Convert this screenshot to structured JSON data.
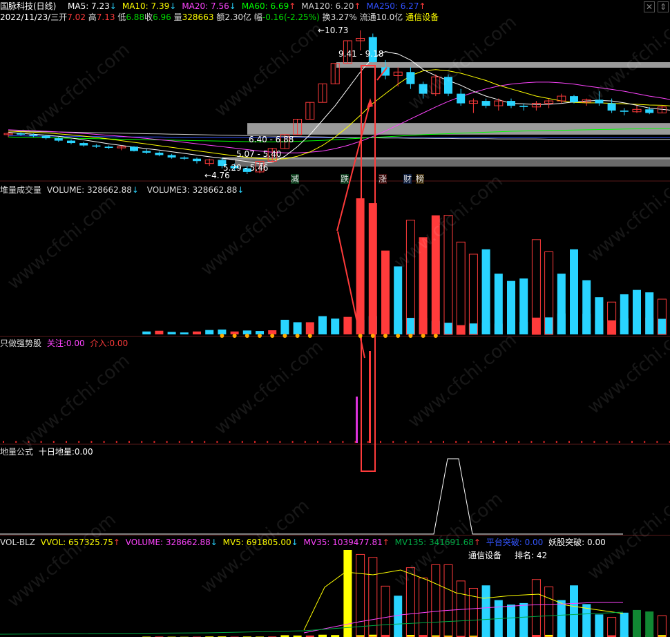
{
  "header": {
    "stock": "国脉科技(日线)",
    "date": "2022/11/23/三",
    "open_label": "开",
    "open": "7.02",
    "high_label": "高",
    "high": "7.13",
    "low_label": "低",
    "low": "6.88",
    "close_label": "收",
    "close": "6.96",
    "vol_label": "量",
    "vol": "328663",
    "amount_label": "额",
    "amount": "2.30亿",
    "chg_label": "幅",
    "chg": "-0.16(-2.25%)",
    "turnover_label": "换",
    "turnover": "3.27%",
    "float_label": "流通",
    "float": "10.0亿",
    "industry": "通信设备"
  },
  "ma_legend": [
    {
      "label": "MA5: 7.23",
      "arrow": "↓",
      "color": "#ffffff",
      "arrow_color": "#29d4ff"
    },
    {
      "label": "MA10: 7.39",
      "arrow": "↓",
      "color": "#ffff00",
      "arrow_color": "#29d4ff"
    },
    {
      "label": "MA20: 7.56",
      "arrow": "↓",
      "color": "#ff44ff",
      "arrow_color": "#29d4ff"
    },
    {
      "label": "MA60: 6.69",
      "arrow": "↑",
      "color": "#00ff00",
      "arrow_color": "#ff3b3b"
    },
    {
      "label": "MA120: 6.20",
      "arrow": "↑",
      "color": "#cccccc",
      "arrow_color": "#ff3b3b"
    },
    {
      "label": "MA250: 6.27",
      "arrow": "↑",
      "color": "#3050ff",
      "arrow_color": "#ff3b3b"
    }
  ],
  "price_annotations": {
    "high_mark": "10.73",
    "low_mark": "4.76",
    "ranges": [
      "9.41 - 9.18",
      "6.40 - 6.88",
      "5.07 - 5.40",
      "5.29 - 5.46"
    ],
    "signals": [
      {
        "text": "减",
        "color": "#00cc66"
      },
      {
        "text": "跌",
        "color": "#00cc66"
      },
      {
        "text": "涨",
        "color": "#ff4444"
      },
      {
        "text": "财",
        "color": "#3399ff"
      },
      {
        "text": "榜",
        "color": "#ff8800"
      }
    ]
  },
  "panel_vol": {
    "title": "堆量成交量",
    "volume": "VOLUME: 328662.88",
    "volume_arrow": "↓",
    "volume3": "VOLUME3: 328662.88",
    "volume3_arrow": "↓"
  },
  "panel_strong": {
    "title": "只做强势股",
    "watch_label": "关注:",
    "watch": "0.00",
    "enter_label": "介入:",
    "enter": "0.00"
  },
  "panel_dl": {
    "title": "地量公式",
    "ten_day": "十日地量:",
    "ten_day_val": "0.00"
  },
  "panel_volblz": {
    "title": "VOL-BLZ",
    "vvol": "VVOL: 657325.75",
    "vvol_arrow": "↑",
    "volume": "VOLUME: 328662.88",
    "volume_arrow": "↓",
    "mv5": "MV5: 691805.00",
    "mv5_arrow": "↓",
    "mv35": "MV35: 1039477.81",
    "mv35_arrow": "↑",
    "mv135": "MV135: 341691.68",
    "mv135_arrow": "↑",
    "platform": "平台突破: 0.00",
    "monster": "妖股突破: 0.00",
    "industry": "通信设备",
    "rank_label": "排名:",
    "rank": "42"
  },
  "watermark": "www.cfchi.com",
  "chart_data": {
    "type": "candlestick",
    "ohlc": [
      [
        6.4,
        6.5,
        6.3,
        6.45
      ],
      [
        6.45,
        6.5,
        6.35,
        6.4
      ],
      [
        6.4,
        6.45,
        6.3,
        6.35
      ],
      [
        6.35,
        6.4,
        6.2,
        6.25
      ],
      [
        6.25,
        6.3,
        6.1,
        6.15
      ],
      [
        6.15,
        6.2,
        6.0,
        6.05
      ],
      [
        6.05,
        6.1,
        5.9,
        5.95
      ],
      [
        5.95,
        6.0,
        5.85,
        5.9
      ],
      [
        5.9,
        5.95,
        5.8,
        5.85
      ],
      [
        5.85,
        5.95,
        5.75,
        5.9
      ],
      [
        5.9,
        5.92,
        5.7,
        5.72
      ],
      [
        5.72,
        5.8,
        5.6,
        5.65
      ],
      [
        5.65,
        5.7,
        5.5,
        5.55
      ],
      [
        5.55,
        5.6,
        5.4,
        5.45
      ],
      [
        5.45,
        5.5,
        5.35,
        5.4
      ],
      [
        5.4,
        5.45,
        5.2,
        5.3
      ],
      [
        5.2,
        5.4,
        5.1,
        5.35
      ],
      [
        5.35,
        5.45,
        5.0,
        5.1
      ],
      [
        5.1,
        5.2,
        4.9,
        5.0
      ],
      [
        5.0,
        5.1,
        4.76,
        4.85
      ],
      [
        4.85,
        5.3,
        4.8,
        5.29
      ],
      [
        5.29,
        5.85,
        5.25,
        5.82
      ],
      [
        5.82,
        6.4,
        5.8,
        6.4
      ],
      [
        6.4,
        7.04,
        6.4,
        7.04
      ],
      [
        7.04,
        7.74,
        7.04,
        7.74
      ],
      [
        7.74,
        8.51,
        7.74,
        8.51
      ],
      [
        8.51,
        9.36,
        8.51,
        9.36
      ],
      [
        9.36,
        10.3,
        9.36,
        10.3
      ],
      [
        10.3,
        10.73,
        9.9,
        10.4
      ],
      [
        10.45,
        10.6,
        9.4,
        9.41
      ],
      [
        9.2,
        9.5,
        8.7,
        8.85
      ],
      [
        8.85,
        9.2,
        8.4,
        9.0
      ],
      [
        9.0,
        9.2,
        8.3,
        8.5
      ],
      [
        8.5,
        8.6,
        7.9,
        8.1
      ],
      [
        8.1,
        8.9,
        8.0,
        8.8
      ],
      [
        8.8,
        8.9,
        8.0,
        8.1
      ],
      [
        8.1,
        8.3,
        7.6,
        7.7
      ],
      [
        7.7,
        7.9,
        7.3,
        7.8
      ],
      [
        7.8,
        7.9,
        7.5,
        7.6
      ],
      [
        7.6,
        7.9,
        7.4,
        7.8
      ],
      [
        7.8,
        7.9,
        7.5,
        7.6
      ],
      [
        7.6,
        7.7,
        7.4,
        7.55
      ],
      [
        7.55,
        7.8,
        7.4,
        7.7
      ],
      [
        7.7,
        7.9,
        7.5,
        7.8
      ],
      [
        7.8,
        8.1,
        7.7,
        8.0
      ],
      [
        8.0,
        8.05,
        7.7,
        7.75
      ],
      [
        7.75,
        7.9,
        7.6,
        7.85
      ],
      [
        7.85,
        8.2,
        7.6,
        7.7
      ],
      [
        7.7,
        7.9,
        7.3,
        7.4
      ],
      [
        7.4,
        7.5,
        7.2,
        7.35
      ],
      [
        7.35,
        7.6,
        7.3,
        7.45
      ],
      [
        7.45,
        7.55,
        7.25,
        7.3
      ],
      [
        7.3,
        7.6,
        7.3,
        7.55
      ],
      [
        7.55,
        7.6,
        7.2,
        7.25
      ],
      [
        7.25,
        7.3,
        7.1,
        7.2
      ],
      [
        7.2,
        7.3,
        6.9,
        7.12
      ],
      [
        7.02,
        7.13,
        6.88,
        6.96
      ]
    ],
    "ma5": [
      6.5,
      6.45,
      6.42,
      6.38,
      6.33,
      6.26,
      6.18,
      6.1,
      6.02,
      5.95,
      5.88,
      5.82,
      5.76,
      5.69,
      5.62,
      5.55,
      5.48,
      5.42,
      5.35,
      5.28,
      5.2,
      5.25,
      5.5,
      5.9,
      6.4,
      7.0,
      7.6,
      8.3,
      9.0,
      9.6,
      9.85,
      9.75,
      9.5,
      9.1,
      8.85,
      8.65,
      8.45,
      8.2,
      8.0,
      7.85,
      7.7,
      7.68,
      7.65,
      7.66,
      7.7,
      7.76,
      7.8,
      7.82,
      7.8,
      7.72,
      7.62,
      7.5,
      7.45,
      7.4,
      7.35,
      7.3,
      7.23
    ],
    "ma10": [
      6.55,
      6.52,
      6.5,
      6.47,
      6.43,
      6.39,
      6.34,
      6.28,
      6.22,
      6.15,
      6.08,
      6.01,
      5.94,
      5.87,
      5.8,
      5.73,
      5.66,
      5.59,
      5.52,
      5.46,
      5.41,
      5.38,
      5.4,
      5.5,
      5.68,
      5.95,
      6.3,
      6.72,
      7.2,
      7.7,
      8.1,
      8.5,
      8.85,
      9.05,
      9.1,
      9.05,
      8.95,
      8.8,
      8.65,
      8.45,
      8.3,
      8.15,
      8.0,
      7.9,
      7.8,
      7.74,
      7.72,
      7.72,
      7.7,
      7.68,
      7.66,
      7.63,
      7.62,
      7.58,
      7.52,
      7.45,
      7.39
    ],
    "ma20": [
      6.6,
      6.58,
      6.56,
      6.54,
      6.51,
      6.48,
      6.45,
      6.41,
      6.37,
      6.33,
      6.29,
      6.24,
      6.19,
      6.14,
      6.08,
      6.02,
      5.96,
      5.9,
      5.84,
      5.78,
      5.72,
      5.67,
      5.64,
      5.64,
      5.67,
      5.72,
      5.82,
      5.95,
      6.12,
      6.32,
      6.55,
      6.8,
      7.05,
      7.3,
      7.55,
      7.78,
      7.98,
      8.15,
      8.3,
      8.42,
      8.5,
      8.55,
      8.58,
      8.58,
      8.55,
      8.5,
      8.42,
      8.35,
      8.28,
      8.2,
      8.1,
      8.0,
      7.92,
      7.82,
      7.72,
      7.64,
      7.56
    ],
    "ma60": [
      6.3,
      6.29,
      6.28,
      6.27,
      6.26,
      6.25,
      6.24,
      6.23,
      6.22,
      6.21,
      6.2,
      6.19,
      6.18,
      6.17,
      6.16,
      6.15,
      6.14,
      6.13,
      6.12,
      6.11,
      6.1,
      6.1,
      6.11,
      6.12,
      6.14,
      6.16,
      6.19,
      6.22,
      6.25,
      6.28,
      6.31,
      6.34,
      6.37,
      6.4,
      6.42,
      6.44,
      6.46,
      6.48,
      6.5,
      6.52,
      6.54,
      6.55,
      6.56,
      6.57,
      6.58,
      6.59,
      6.6,
      6.61,
      6.62,
      6.63,
      6.64,
      6.65,
      6.66,
      6.67,
      6.68,
      6.68,
      6.69
    ],
    "ma120": [
      6.55,
      6.54,
      6.53,
      6.52,
      6.51,
      6.5,
      6.49,
      6.48,
      6.47,
      6.46,
      6.45,
      6.44,
      6.43,
      6.42,
      6.41,
      6.4,
      6.39,
      6.38,
      6.37,
      6.36,
      6.35,
      6.34,
      6.33,
      6.32,
      6.31,
      6.3,
      6.29,
      6.28,
      6.27,
      6.27,
      6.26,
      6.26,
      6.25,
      6.25,
      6.24,
      6.24,
      6.23,
      6.23,
      6.23,
      6.22,
      6.22,
      6.22,
      6.22,
      6.21,
      6.21,
      6.21,
      6.21,
      6.21,
      6.2,
      6.2,
      6.2,
      6.2,
      6.2,
      6.2,
      6.2,
      6.2,
      6.2
    ],
    "ma250": [
      6.35,
      6.35,
      6.34,
      6.34,
      6.33,
      6.33,
      6.32,
      6.32,
      6.31,
      6.31,
      6.3,
      6.3,
      6.3,
      6.29,
      6.29,
      6.29,
      6.28,
      6.28,
      6.28,
      6.28,
      6.27,
      6.27,
      6.27,
      6.27,
      6.27,
      6.27,
      6.27,
      6.27,
      6.27,
      6.27,
      6.27,
      6.27,
      6.27,
      6.27,
      6.27,
      6.27,
      6.27,
      6.27,
      6.27,
      6.27,
      6.27,
      6.27,
      6.27,
      6.27,
      6.27,
      6.27,
      6.27,
      6.27,
      6.27,
      6.27,
      6.27,
      6.27,
      6.27,
      6.27,
      6.27,
      6.27,
      6.27
    ],
    "volume_visible_from": 11,
    "volume": [
      0,
      0,
      0,
      0,
      0,
      0,
      0,
      0,
      0,
      0,
      0,
      12000,
      15000,
      10000,
      8000,
      12000,
      18000,
      20000,
      12000,
      16000,
      14000,
      17000,
      60000,
      50000,
      50000,
      75000,
      65000,
      72000,
      60000,
      75000,
      70000,
      60000,
      68000,
      68000,
      55000,
      48000,
      38000,
      45000,
      48000,
      44000,
      54000,
      51000,
      69000,
      70000,
      86000,
      50000,
      85000,
      58000,
      58000,
      66000,
      70000,
      69000,
      64000,
      73000,
      72000,
      45000,
      41000
    ],
    "volume_big_bars": [
      {
        "i": 28,
        "v": 560000,
        "up": true
      },
      {
        "i": 29,
        "v": 540000,
        "up": true
      },
      {
        "i": 30,
        "v": 345000,
        "up": true
      },
      {
        "i": 31,
        "v": 280000,
        "up": false
      },
      {
        "i": 32,
        "v": 470000,
        "up": true
      },
      {
        "i": 33,
        "v": 400000,
        "up": true
      },
      {
        "i": 34,
        "v": 490000,
        "up": true
      },
      {
        "i": 35,
        "v": 490000,
        "up": true
      },
      {
        "i": 36,
        "v": 380000,
        "up": true
      },
      {
        "i": 37,
        "v": 330000,
        "up": true
      },
      {
        "i": 38,
        "v": 350000,
        "up": false
      },
      {
        "i": 39,
        "v": 250000,
        "up": false
      },
      {
        "i": 40,
        "v": 220000,
        "up": false
      },
      {
        "i": 41,
        "v": 230000,
        "up": false
      },
      {
        "i": 42,
        "v": 390000,
        "up": true
      },
      {
        "i": 43,
        "v": 340000,
        "up": true
      },
      {
        "i": 44,
        "v": 250000,
        "up": false
      },
      {
        "i": 45,
        "v": 350000,
        "up": false
      },
      {
        "i": 46,
        "v": 223000,
        "up": false
      },
      {
        "i": 47,
        "v": 153000,
        "up": false
      },
      {
        "i": 48,
        "v": 133000,
        "up": true
      },
      {
        "i": 49,
        "v": 165000,
        "up": false
      },
      {
        "i": 50,
        "v": 183000,
        "up": false
      },
      {
        "i": 51,
        "v": 173000,
        "up": false
      },
      {
        "i": 52,
        "v": 145000,
        "up": true
      },
      {
        "i": 53,
        "v": 142000,
        "up": true
      },
      {
        "i": 54,
        "v": 75000,
        "up": false
      }
    ],
    "strong_enter": [
      {
        "i": 30,
        "v": 0.86
      },
      {
        "i": 29,
        "v": 0.39
      }
    ],
    "dl_signal_range": [
      36,
      38
    ]
  }
}
